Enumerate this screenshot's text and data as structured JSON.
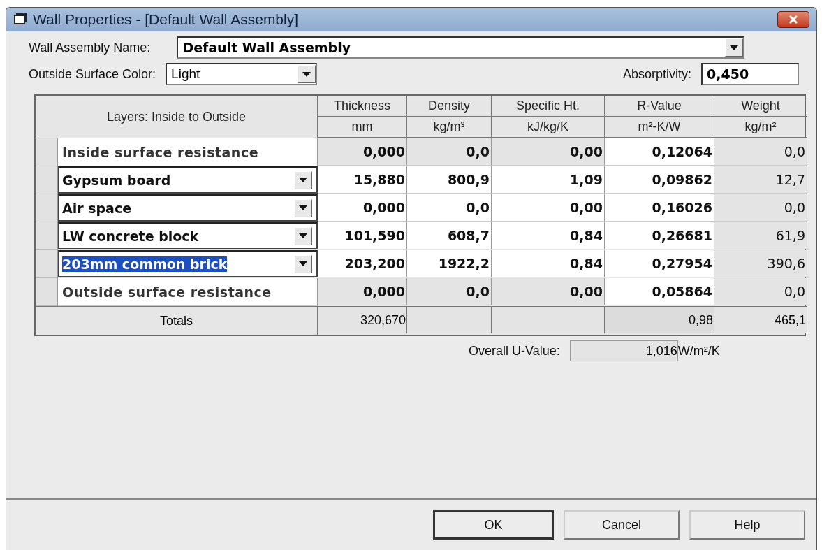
{
  "window": {
    "title": "Wall Properties - [Default Wall Assembly]"
  },
  "name_field": {
    "label": "Wall Assembly Name:",
    "value": "Default Wall Assembly"
  },
  "color_field": {
    "label": "Outside Surface Color:",
    "value": "Light"
  },
  "absorptivity": {
    "label": "Absorptivity:",
    "value": "0,450"
  },
  "table": {
    "columns": [
      {
        "title": "Layers: Inside to Outside"
      },
      {
        "title": "Thickness",
        "unit": "mm"
      },
      {
        "title": "Density",
        "unit": "kg/m³"
      },
      {
        "title": "Specific Ht.",
        "unit": "kJ/kg/K"
      },
      {
        "title": "R-Value",
        "unit": "m²-K/W"
      },
      {
        "title": "Weight",
        "unit": "kg/m²"
      }
    ],
    "rows": [
      {
        "kind": "fixed",
        "layer": "Inside surface resistance",
        "thickness": "0,000",
        "density": "0,0",
        "specific_ht": "0,00",
        "r_value": "0,12064",
        "weight": "0,0"
      },
      {
        "kind": "material",
        "layer": "Gypsum board",
        "selected": false,
        "thickness": "15,880",
        "density": "800,9",
        "specific_ht": "1,09",
        "r_value": "0,09862",
        "weight": "12,7"
      },
      {
        "kind": "material",
        "layer": "Air space",
        "selected": false,
        "thickness": "0,000",
        "density": "0,0",
        "specific_ht": "0,00",
        "r_value": "0,16026",
        "weight": "0,0"
      },
      {
        "kind": "material",
        "layer": "LW concrete block",
        "selected": false,
        "thickness": "101,590",
        "density": "608,7",
        "specific_ht": "0,84",
        "r_value": "0,26681",
        "weight": "61,9"
      },
      {
        "kind": "material",
        "layer": "203mm common brick",
        "selected": true,
        "thickness": "203,200",
        "density": "1922,2",
        "specific_ht": "0,84",
        "r_value": "0,27954",
        "weight": "390,6"
      },
      {
        "kind": "fixed",
        "layer": "Outside surface resistance",
        "thickness": "0,000",
        "density": "0,0",
        "specific_ht": "0,00",
        "r_value": "0,05864",
        "weight": "0,0"
      }
    ],
    "totals": {
      "label": "Totals",
      "thickness": "320,670",
      "r_value": "0,98",
      "weight": "465,1"
    }
  },
  "u_value": {
    "label": "Overall U-Value:",
    "value": "1,016",
    "unit": "W/m²/K"
  },
  "buttons": [
    {
      "label": "OK",
      "default": true
    },
    {
      "label": "Cancel",
      "default": false
    },
    {
      "label": "Help",
      "default": false
    }
  ]
}
